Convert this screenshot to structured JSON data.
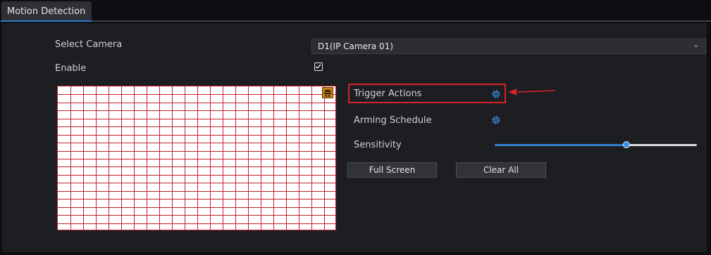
{
  "tabs": [
    {
      "label": "Motion Detection",
      "active": true
    }
  ],
  "form": {
    "select_camera_label": "Select Camera",
    "select_camera_value": "D1(IP Camera 01)",
    "enable_label": "Enable",
    "enable_checked": true
  },
  "settings": {
    "trigger_actions_label": "Trigger Actions",
    "arming_schedule_label": "Arming Schedule",
    "sensitivity_label": "Sensitivity",
    "sensitivity_level": 0.65
  },
  "buttons": {
    "full_screen": "Full Screen",
    "clear_all": "Clear All"
  },
  "colors": {
    "accent": "#2f7fd2",
    "highlight": "#d8232a",
    "grid_line": "#c41e2b"
  },
  "icons": {
    "settings": "gear-icon",
    "dropdown": "chevron-down-icon",
    "camera_badge": "camera-position-icon",
    "annotation": "arrow-left-icon"
  }
}
